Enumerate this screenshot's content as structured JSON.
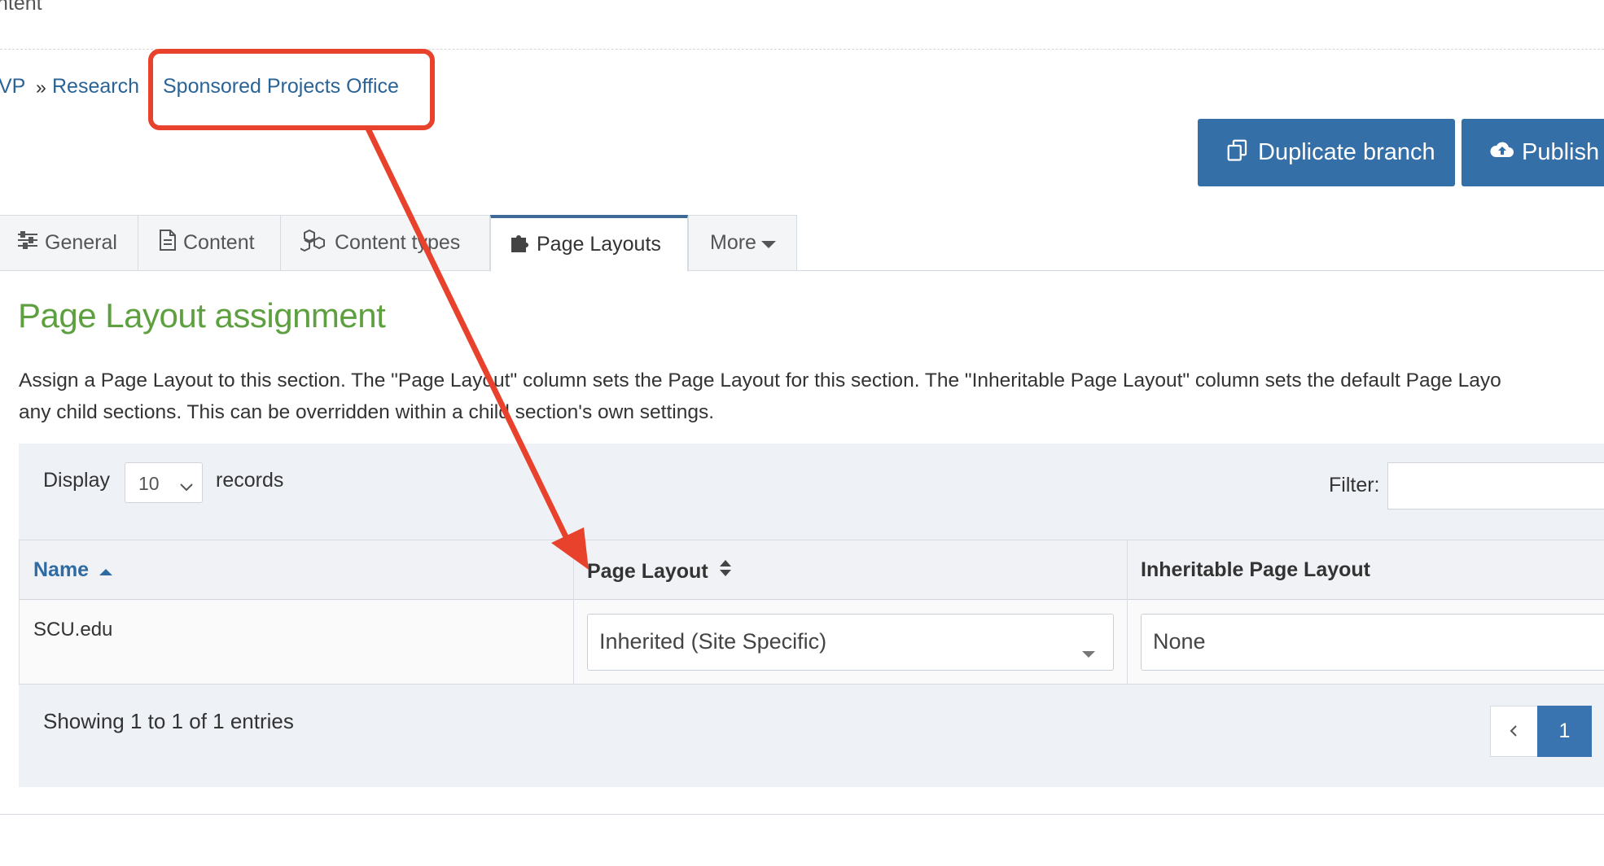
{
  "page": {
    "top_title": "ntent"
  },
  "breadcrumb": {
    "items": [
      "VP",
      "Research",
      "Sponsored Projects Office"
    ],
    "separator": "»"
  },
  "actions": {
    "duplicate_label": "Duplicate branch",
    "publish_label": "Publish s"
  },
  "tabs": [
    {
      "label": "General",
      "icon": "sliders-icon"
    },
    {
      "label": "Content",
      "icon": "document-icon"
    },
    {
      "label": "Content types",
      "icon": "cubes-icon"
    },
    {
      "label": "Page Layouts",
      "icon": "puzzle-icon",
      "active": true
    },
    {
      "label": "More",
      "icon": "caret-down-icon"
    }
  ],
  "section": {
    "title": "Page Layout assignment",
    "description_line1": "Assign a Page Layout to this section. The \"Page Layout\" column sets the Page Layout for this section. The \"Inheritable Page Layout\" column sets the default Page Layo",
    "description_line2": "any child sections. This can be overridden within a child section's own settings."
  },
  "table_controls": {
    "display_label": "Display",
    "page_size": "10",
    "records_label": "records",
    "filter_label": "Filter:",
    "filter_value": ""
  },
  "table": {
    "columns": [
      "Name",
      "Page Layout",
      "Inheritable Page Layout"
    ],
    "rows": [
      {
        "name": "SCU.edu",
        "page_layout": "Inherited (Site Specific)",
        "inheritable_page_layout": "None"
      }
    ]
  },
  "footer": {
    "showing": "Showing 1 to 1 of 1 entries",
    "prev": "‹",
    "current_page": "1"
  },
  "colors": {
    "accent": "#356fa8",
    "annotation": "#e8412c",
    "title_green": "#5ea03f"
  }
}
